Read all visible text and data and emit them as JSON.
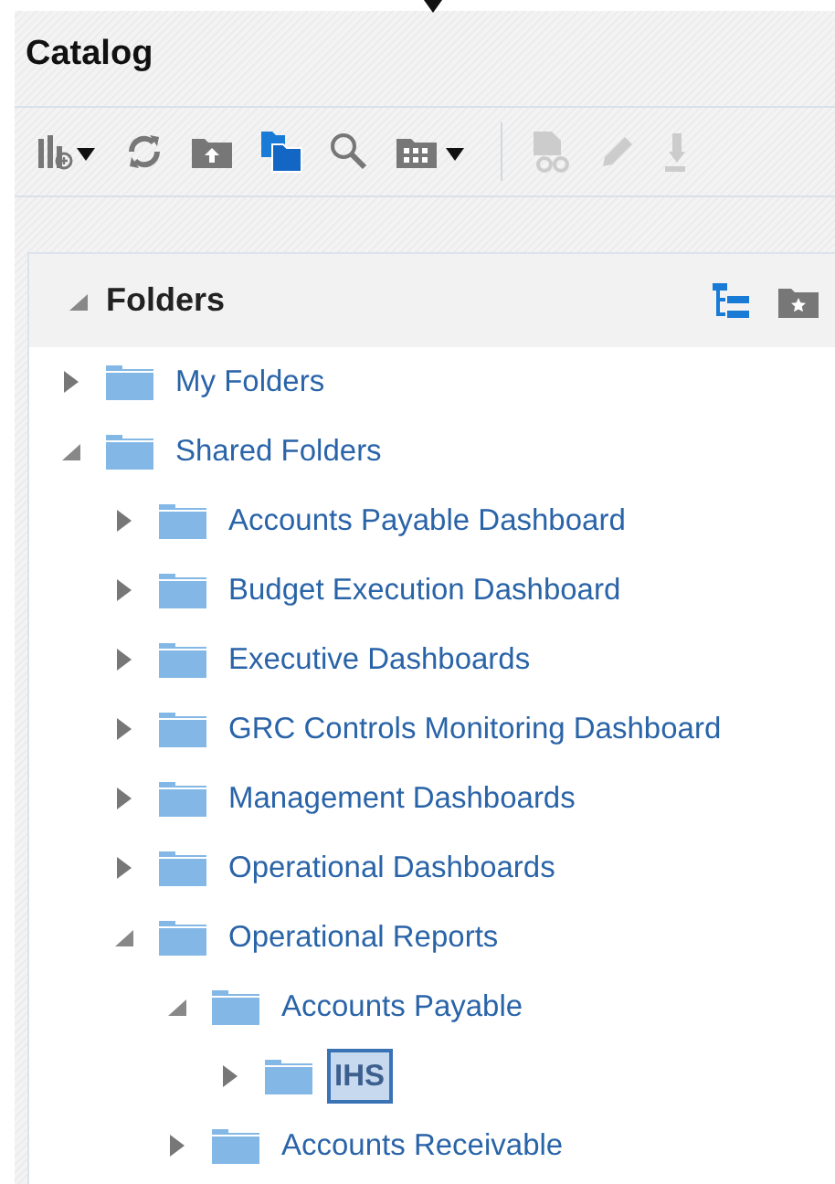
{
  "title": "Catalog",
  "panel": {
    "title": "Folders",
    "expanded": true
  },
  "tree": [
    {
      "label": "My Folders",
      "expanded": false,
      "selected": false
    },
    {
      "label": "Shared Folders",
      "expanded": true,
      "selected": false,
      "children": [
        {
          "label": "Accounts Payable Dashboard",
          "expanded": false,
          "selected": false
        },
        {
          "label": "Budget Execution Dashboard",
          "expanded": false,
          "selected": false
        },
        {
          "label": "Executive Dashboards",
          "expanded": false,
          "selected": false
        },
        {
          "label": "GRC Controls Monitoring Dashboard",
          "expanded": false,
          "selected": false
        },
        {
          "label": "Management Dashboards",
          "expanded": false,
          "selected": false
        },
        {
          "label": "Operational Dashboards",
          "expanded": false,
          "selected": false
        },
        {
          "label": "Operational Reports",
          "expanded": true,
          "selected": false,
          "children": [
            {
              "label": "Accounts Payable",
              "expanded": true,
              "selected": false,
              "children": [
                {
                  "label": "IHS",
                  "expanded": false,
                  "selected": true
                }
              ]
            },
            {
              "label": "Accounts Receivable",
              "expanded": false,
              "selected": false
            }
          ]
        }
      ]
    }
  ]
}
